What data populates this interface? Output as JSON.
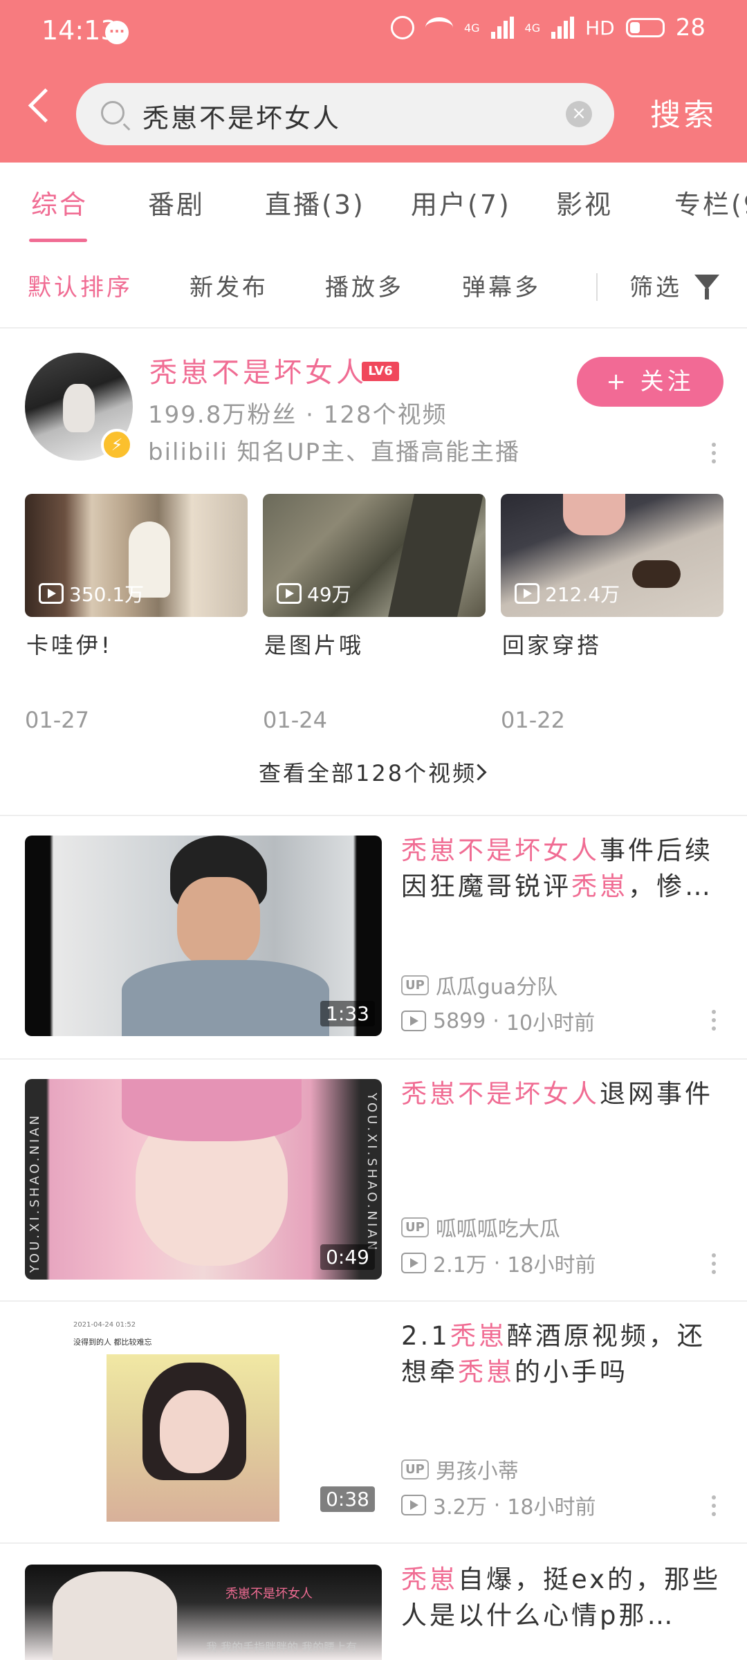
{
  "status": {
    "time": "14:13",
    "battery": "28",
    "net1": "4G",
    "net2": "4G",
    "hd": "HD"
  },
  "search": {
    "query": "秃崽不是坏女人",
    "button": "搜索"
  },
  "tabs": [
    "综合",
    "番剧",
    "直播(3)",
    "用户(7)",
    "影视",
    "专栏(9"
  ],
  "sorts": [
    "默认排序",
    "新发布",
    "播放多",
    "弹幕多",
    "筛选"
  ],
  "user": {
    "name": "秃崽不是坏女人",
    "level": "LV6",
    "stats": "199.8万粉丝 · 128个视频",
    "desc": "bilibili 知名UP主、直播高能主播",
    "follow": "+ 关注"
  },
  "user_videos": [
    {
      "plays": "350.1万",
      "title": "卡哇伊!",
      "date": "01-27"
    },
    {
      "plays": "49万",
      "title": "是图片哦",
      "date": "01-24"
    },
    {
      "plays": "212.4万",
      "title": "回家穿搭",
      "date": "01-22"
    }
  ],
  "view_all": "查看全部128个视频",
  "results": [
    {
      "title_parts": [
        [
          "hl",
          "秃崽不是坏女人"
        ],
        [
          "n",
          "事件后续因狂魔哥锐评"
        ],
        [
          "hl",
          "秃崽"
        ],
        [
          "n",
          "，惨…"
        ]
      ],
      "duration": "1:33",
      "up": "瓜瓜gua分队",
      "plays": "5899",
      "time": "10小时前"
    },
    {
      "title_parts": [
        [
          "hl",
          "秃崽不是坏女人"
        ],
        [
          "n",
          "退网事件"
        ]
      ],
      "duration": "0:49",
      "up": "呱呱呱吃大瓜",
      "plays": "2.1万",
      "time": "18小时前"
    },
    {
      "title_parts": [
        [
          "n",
          "2.1"
        ],
        [
          "hl",
          "秃崽"
        ],
        [
          "n",
          "醉酒原视频，还想牵"
        ],
        [
          "hl",
          "秃崽"
        ],
        [
          "n",
          "的小手吗"
        ]
      ],
      "duration": "0:38",
      "up": "男孩小蒂",
      "plays": "3.2万",
      "time": "18小时前"
    },
    {
      "title_parts": [
        [
          "hl",
          "秃崽"
        ],
        [
          "n",
          "自爆，挺ex的，那些人是以什么心情p那…"
        ]
      ],
      "duration": "",
      "up": "",
      "plays": "",
      "time": ""
    }
  ],
  "thumb_overlays": {
    "r3_date": "2021-04-24 01:52",
    "r3_caption": "没得到的人 都比较难忘",
    "r2_side": "YOU.XI.SHAO.NIAN",
    "r4_name": "秃崽不是坏女人",
    "r4_caption": "我 我的手指胖胖的 我的腰上有"
  },
  "colors": {
    "header": "#f77b7f",
    "accent": "#f06c93",
    "follow": "#f26a95",
    "level": "#f0475b"
  }
}
